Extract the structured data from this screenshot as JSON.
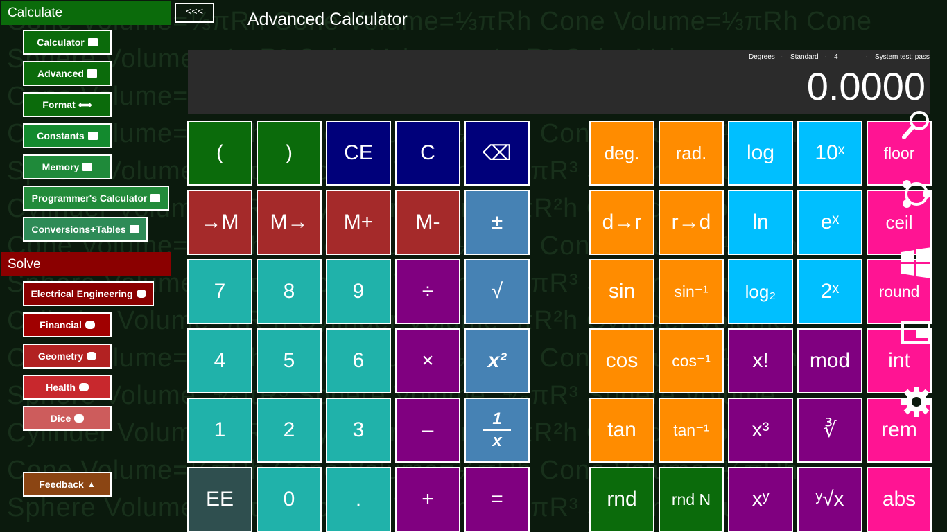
{
  "background_text": [
    "Cone Volume=⅓πRh     Cone Volume=⅓πRh     Cone Volume=⅓πRh     Cone",
    "Sphere Volume=⁴⁄₃πR³     Cube Volume=⁴⁄₃πR³     Cube Volume",
    "Cone Volume=⅓πRh",
    "Cone Volume=⅓πRh     Cone Volume=⅓πRh     Cone Volume=⅓πRh",
    "Sphere Volume=⁴⁄₃πR³     Sphere Volume=⁴⁄₃πR³     Sphere Volume",
    "Cylinder Volume=πR²h     Cylinder Volume=πR²h     Cylinder Volume",
    "Cone Volume=⅓πRh     Cone Volume=⅓πRh     Cone Volume=⅓πRh",
    "Sphere Volume=⁴⁄₃πR³     Sphere Volume=⁴⁄₃πR³     Sphere Volume",
    "Cylinder Volume=πR²h     Cylinder Volume=πR²h     Cylinder Volume",
    "Cone Volume=⅓πRh     Cone Volume=⅓πRh     Cone Volume=⅓πRh",
    "Sphere Volume=⁴⁄₃πR³     Sphere Volume=⁴⁄₃πR³     Sphere Volume",
    "Cylinder Volume=πR²h     Cylinder Volume=πR²h     Cylinder Volume",
    "Cone Volume=⅓πRh     Cone Volume=⅓πRh     Cone Volume=⅓πRh",
    "Sphere Volume=⁴⁄₃πR³     Sphere Volume=⁴⁄₃πR³     Sphere Volume"
  ],
  "sidebar": {
    "calculate_header": "Calculate",
    "calculate_items": [
      {
        "label": "Calculator",
        "color": "#0b6b0b"
      },
      {
        "label": "Advanced",
        "color": "#0b6b0b"
      },
      {
        "label": "Format ⟺",
        "color": "#0b6b0b"
      },
      {
        "label": "Constants",
        "color": "#138a2e"
      },
      {
        "label": "Memory",
        "color": "#1f8a3a"
      },
      {
        "label": "Programmer's Calculator",
        "color": "#228b3a"
      },
      {
        "label": "Conversions+Tables",
        "color": "#2e8b57"
      }
    ],
    "solve_header": "Solve",
    "solve_items": [
      {
        "label": "Electrical Engineering",
        "color": "#8b0000"
      },
      {
        "label": "Financial",
        "color": "#a00000"
      },
      {
        "label": "Geometry",
        "color": "#b22222"
      },
      {
        "label": "Health",
        "color": "#c8282d"
      },
      {
        "label": "Dice",
        "color": "#cd5c5c"
      }
    ],
    "feedback_label": "Feedback",
    "feedback_color": "#8b4513"
  },
  "header": {
    "back_label": "<<<",
    "title": "Advanced Calculator"
  },
  "display": {
    "angle_mode": "Degrees",
    "dot1": "·",
    "notation": "Standard",
    "dot2": "·",
    "precision": "4",
    "dot3": "·",
    "system_test": "System test: pass",
    "value": "0.0000"
  },
  "keypad_left": [
    [
      {
        "l": "(",
        "c": "k-green"
      },
      {
        "l": ")",
        "c": "k-green"
      },
      {
        "l": "CE",
        "c": "k-navy"
      },
      {
        "l": "C",
        "c": "k-navy"
      },
      {
        "l": "⌫",
        "c": "k-navy"
      }
    ],
    [
      {
        "l": "→M",
        "c": "k-red"
      },
      {
        "l": "M→",
        "c": "k-red"
      },
      {
        "l": "M+",
        "c": "k-red"
      },
      {
        "l": "M-",
        "c": "k-red"
      },
      {
        "l": "±",
        "c": "k-steel"
      }
    ],
    [
      {
        "l": "7",
        "c": "k-teal"
      },
      {
        "l": "8",
        "c": "k-teal"
      },
      {
        "l": "9",
        "c": "k-teal"
      },
      {
        "l": "÷",
        "c": "k-purple"
      },
      {
        "l": "√",
        "c": "k-steel"
      }
    ],
    [
      {
        "l": "4",
        "c": "k-teal"
      },
      {
        "l": "5",
        "c": "k-teal"
      },
      {
        "l": "6",
        "c": "k-teal"
      },
      {
        "l": "×",
        "c": "k-purple"
      },
      {
        "l": "x²",
        "c": "k-steel"
      }
    ],
    [
      {
        "l": "1",
        "c": "k-teal"
      },
      {
        "l": "2",
        "c": "k-teal"
      },
      {
        "l": "3",
        "c": "k-teal"
      },
      {
        "l": "–",
        "c": "k-purple"
      },
      {
        "l": "1/x",
        "c": "k-steel"
      }
    ],
    [
      {
        "l": "EE",
        "c": "k-slate"
      },
      {
        "l": "0",
        "c": "k-teal"
      },
      {
        "l": ".",
        "c": "k-teal"
      },
      {
        "l": "+",
        "c": "k-purple"
      },
      {
        "l": "=",
        "c": "k-purple"
      }
    ]
  ],
  "keypad_right": [
    [
      {
        "l": "deg.",
        "c": "k-orange"
      },
      {
        "l": "rad.",
        "c": "k-orange"
      },
      {
        "l": "log",
        "c": "k-cyan"
      },
      {
        "l": "10ˣ",
        "c": "k-cyan"
      },
      {
        "l": "floor",
        "c": "k-pink"
      }
    ],
    [
      {
        "l": "d→r",
        "c": "k-orange"
      },
      {
        "l": "r→d",
        "c": "k-orange"
      },
      {
        "l": "ln",
        "c": "k-cyan"
      },
      {
        "l": "eˣ",
        "c": "k-cyan"
      },
      {
        "l": "ceil",
        "c": "k-pink"
      }
    ],
    [
      {
        "l": "sin",
        "c": "k-orange"
      },
      {
        "l": "sin⁻¹",
        "c": "k-orange"
      },
      {
        "l": "log₂",
        "c": "k-cyan"
      },
      {
        "l": "2ˣ",
        "c": "k-cyan"
      },
      {
        "l": "round",
        "c": "k-pink"
      }
    ],
    [
      {
        "l": "cos",
        "c": "k-orange"
      },
      {
        "l": "cos⁻¹",
        "c": "k-orange"
      },
      {
        "l": "x!",
        "c": "k-purple"
      },
      {
        "l": "mod",
        "c": "k-purple"
      },
      {
        "l": "int",
        "c": "k-pink"
      }
    ],
    [
      {
        "l": "tan",
        "c": "k-orange"
      },
      {
        "l": "tan⁻¹",
        "c": "k-orange"
      },
      {
        "l": "x³",
        "c": "k-purple"
      },
      {
        "l": "∛",
        "c": "k-purple"
      },
      {
        "l": "rem",
        "c": "k-pink"
      }
    ],
    [
      {
        "l": "rnd",
        "c": "k-green"
      },
      {
        "l": "rnd N",
        "c": "k-green"
      },
      {
        "l": "xʸ",
        "c": "k-purple"
      },
      {
        "l": "ʸ√x",
        "c": "k-purple"
      },
      {
        "l": "abs",
        "c": "k-pink"
      }
    ]
  ],
  "charms": [
    "search-icon",
    "share-icon",
    "start-icon",
    "devices-icon",
    "settings-icon"
  ]
}
